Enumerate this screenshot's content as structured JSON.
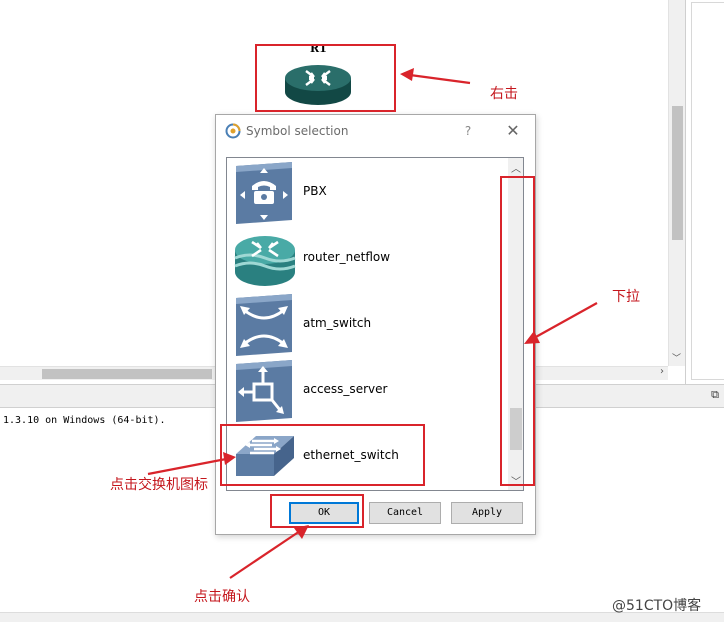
{
  "canvas": {
    "node_label": "R1"
  },
  "console": {
    "text": "1.3.10 on Windows (64-bit)."
  },
  "dialog": {
    "title": "Symbol selection",
    "help": "?",
    "close": "✕",
    "symbols": [
      {
        "label": "PBX",
        "icon": "pbx-icon"
      },
      {
        "label": "router_netflow",
        "icon": "router-netflow-icon"
      },
      {
        "label": "atm_switch",
        "icon": "atm-switch-icon"
      },
      {
        "label": "access_server",
        "icon": "access-server-icon"
      },
      {
        "label": "ethernet_switch",
        "icon": "ethernet-switch-icon"
      }
    ],
    "buttons": {
      "ok": "OK",
      "cancel": "Cancel",
      "apply": "Apply"
    }
  },
  "annotations": {
    "right_click": "右击",
    "scroll_down": "下拉",
    "click_switch_icon": "点击交换机图标",
    "click_confirm": "点击确认"
  },
  "watermark": "@51CTO博客",
  "colors": {
    "annotation_red": "#d9242b",
    "router_teal": "#1d5f5c",
    "icon_blue": "#5b7ba3"
  }
}
